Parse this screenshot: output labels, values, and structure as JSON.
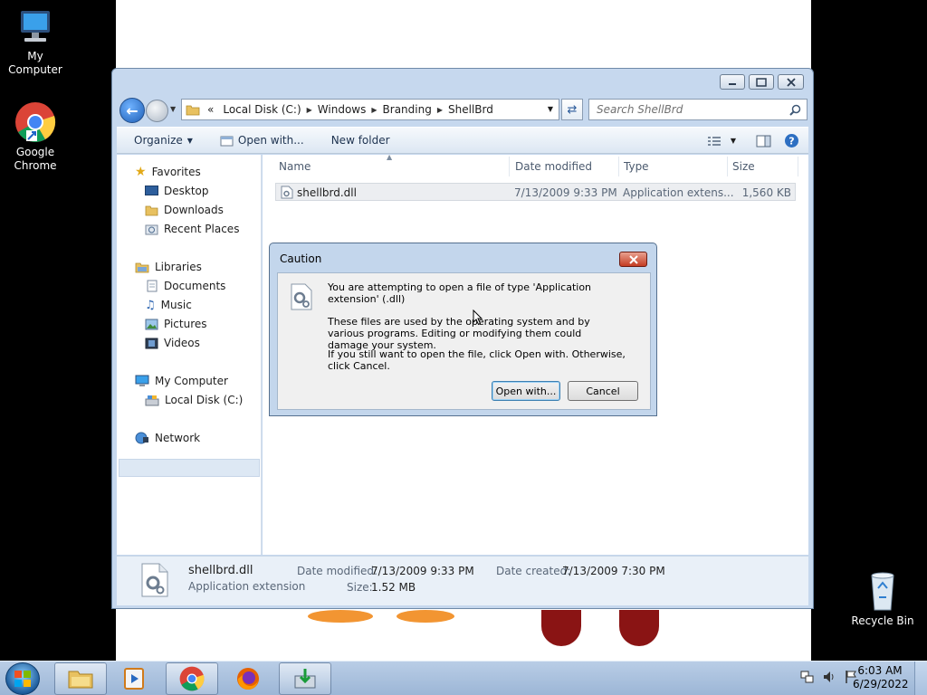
{
  "desktop": {
    "icons": [
      {
        "label": "My Computer"
      },
      {
        "label": "Google Chrome"
      },
      {
        "label": "Recycle Bin"
      }
    ]
  },
  "explorer": {
    "address": {
      "overflow": "«",
      "crumbs": [
        "Local Disk (C:)",
        "Windows",
        "Branding",
        "ShellBrd"
      ]
    },
    "search_placeholder": "Search ShellBrd",
    "toolbar": {
      "organize": "Organize",
      "open_with": "Open with...",
      "new_folder": "New folder"
    },
    "nav": {
      "favorites": "Favorites",
      "desktop": "Desktop",
      "downloads": "Downloads",
      "recent_places": "Recent Places",
      "libraries": "Libraries",
      "documents": "Documents",
      "music": "Music",
      "pictures": "Pictures",
      "videos": "Videos",
      "my_computer": "My Computer",
      "local_disk": "Local Disk (C:)",
      "network": "Network"
    },
    "columns": {
      "name": "Name",
      "date_modified": "Date modified",
      "type": "Type",
      "size": "Size"
    },
    "files": [
      {
        "name": "shellbrd.dll",
        "date_modified": "7/13/2009 9:33 PM",
        "type": "Application extens...",
        "size": "1,560 KB"
      }
    ],
    "details": {
      "file_name": "shellbrd.dll",
      "file_type": "Application extension",
      "date_modified_label": "Date modified:",
      "date_modified": "7/13/2009 9:33 PM",
      "size_label": "Size:",
      "size": "1.52 MB",
      "date_created_label": "Date created:",
      "date_created": "7/13/2009 7:30 PM"
    }
  },
  "dialog": {
    "title": "Caution",
    "line1": "You are attempting to open a file of type 'Application extension' (.dll)",
    "line2": "These files are used by the operating system and by various programs. Editing or modifying them could damage your system.",
    "line3": "If you still want to open the file, click Open with. Otherwise, click Cancel.",
    "open_with_button": "Open with...",
    "cancel_button": "Cancel"
  },
  "taskbar": {
    "time": "6:03 AM",
    "date": "6/29/2022",
    "pinned": [
      "explorer-icon",
      "media-player-icon",
      "chrome-icon",
      "firefox-icon",
      "download-app-icon"
    ]
  },
  "colors": {
    "window_frame": "#c6d8ee",
    "selection": "#dde8f4",
    "close_red": "#c43c22",
    "taskbar": "#9cb6d6"
  }
}
